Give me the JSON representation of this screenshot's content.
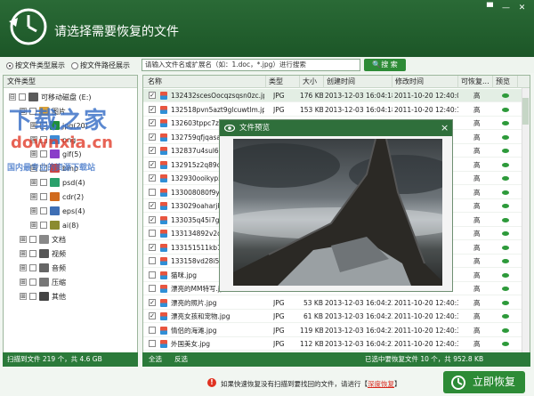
{
  "window": {
    "title": "请选择需要恢复的文件",
    "btn_menu": "▀",
    "btn_min": "—",
    "btn_close": "✕"
  },
  "toolbar": {
    "radio_type": "按文件类型展示",
    "radio_path": "按文件路径展示",
    "search_placeholder": "请输入文件名或扩展名（如：1.doc，*.jpg）进行搜索",
    "search_button": "搜 索"
  },
  "left_panel": {
    "header": "文件类型",
    "tree": [
      {
        "pm": "⊟",
        "label": "可移动磁盘 (E:)",
        "indent": 0
      },
      {
        "pm": "⊟",
        "label": "图片",
        "indent": 1
      },
      {
        "pm": "⊞",
        "label": "jpg(20)",
        "indent": 2
      },
      {
        "pm": "⊞",
        "label": "png",
        "indent": 2
      },
      {
        "pm": "⊞",
        "label": "gif(5)",
        "indent": 2
      },
      {
        "pm": "⊞",
        "label": "bmp",
        "indent": 2
      },
      {
        "pm": "⊞",
        "label": "psd(4)",
        "indent": 2
      },
      {
        "pm": "⊞",
        "label": "cdr(2)",
        "indent": 2
      },
      {
        "pm": "⊞",
        "label": "eps(4)",
        "indent": 2
      },
      {
        "pm": "⊞",
        "label": "ai(8)",
        "indent": 2
      },
      {
        "pm": "⊞",
        "label": "文档",
        "indent": 1
      },
      {
        "pm": "⊞",
        "label": "视频",
        "indent": 1
      },
      {
        "pm": "⊞",
        "label": "音频",
        "indent": 1
      },
      {
        "pm": "⊞",
        "label": "压缩",
        "indent": 1
      },
      {
        "pm": "⊞",
        "label": "其他",
        "indent": 1
      }
    ],
    "footer": "扫描到文件 219 个，共 4.6 GB"
  },
  "watermark": {
    "line1": "下载之家",
    "line2": "downxia.cn",
    "line3": "国内最专业的资源下载站"
  },
  "table": {
    "columns": [
      "名称",
      "类型",
      "大小",
      "创建时间",
      "修改时间",
      "可恢复...",
      "预览"
    ],
    "rows": [
      {
        "checked": true,
        "name": "132432scesOocqzsqsn0zc.jpg",
        "type": "JPG",
        "size": "176 KB",
        "created": "2013-12-03 16:04:18",
        "modified": "2011-10-20 12:40:08",
        "recover": "高"
      },
      {
        "checked": true,
        "name": "132518pvn5azt9glcuwtlm.jpg",
        "type": "JPG",
        "size": "153 KB",
        "created": "2013-12-03 16:04:18",
        "modified": "2011-10-20 12:40:10",
        "recover": "高"
      },
      {
        "checked": true,
        "name": "132603tppc7z89",
        "type": "",
        "size": "",
        "created": "",
        "modified": "",
        "recover": "高"
      },
      {
        "checked": true,
        "name": "132759qfjqasaa7",
        "type": "",
        "size": "",
        "created": "",
        "modified": "",
        "recover": "高"
      },
      {
        "checked": true,
        "name": "132837u4sul62f8",
        "type": "",
        "size": "",
        "created": "",
        "modified": "",
        "recover": "高"
      },
      {
        "checked": true,
        "name": "132915z2q89ccq6",
        "type": "",
        "size": "",
        "created": "",
        "modified": "",
        "recover": "高"
      },
      {
        "checked": true,
        "name": "132930ooikyp5h",
        "type": "",
        "size": "",
        "created": "",
        "modified": "",
        "recover": "高"
      },
      {
        "checked": false,
        "name": "133008080f9y7h",
        "type": "",
        "size": "",
        "created": "",
        "modified": "",
        "recover": "高"
      },
      {
        "checked": true,
        "name": "133029oaharjkoc",
        "type": "",
        "size": "",
        "created": "",
        "modified": "",
        "recover": "高"
      },
      {
        "checked": true,
        "name": "133035q45i7gq89",
        "type": "",
        "size": "",
        "created": "",
        "modified": "",
        "recover": "高"
      },
      {
        "checked": false,
        "name": "133134892v2ql9l",
        "type": "",
        "size": "",
        "created": "",
        "modified": "",
        "recover": "高"
      },
      {
        "checked": true,
        "name": "133151511kb1kt1",
        "type": "",
        "size": "",
        "created": "",
        "modified": "",
        "recover": "高"
      },
      {
        "checked": false,
        "name": "133158vd28i5f4k",
        "type": "",
        "size": "",
        "created": "",
        "modified": "",
        "recover": "高"
      },
      {
        "checked": false,
        "name": "猫咪.jpg",
        "type": "",
        "size": "",
        "created": "",
        "modified": "",
        "recover": "高"
      },
      {
        "checked": false,
        "name": "漂亮的MM特写.jp",
        "type": "",
        "size": "",
        "created": "",
        "modified": "",
        "recover": "高"
      },
      {
        "checked": true,
        "name": "漂亮的照片.jpg",
        "type": "JPG",
        "size": "53 KB",
        "created": "2013-12-03 16:04:23",
        "modified": "2011-10-20 12:40:34",
        "recover": "高"
      },
      {
        "checked": true,
        "name": "漂亮女孩和宠物.jpg",
        "type": "JPG",
        "size": "61 KB",
        "created": "2013-12-03 16:04:23",
        "modified": "2011-10-20 12:40:30",
        "recover": "高"
      },
      {
        "checked": false,
        "name": "情侣的海滩.jpg",
        "type": "JPG",
        "size": "119 KB",
        "created": "2013-12-03 16:04:23",
        "modified": "2011-10-20 12:40:34",
        "recover": "高"
      },
      {
        "checked": false,
        "name": "外国美女.jpg",
        "type": "JPG",
        "size": "112 KB",
        "created": "2013-12-03 16:04:23",
        "modified": "2011-10-20 12:40:38",
        "recover": "高"
      }
    ],
    "select_all": "全选",
    "invert": "反选",
    "footer_status": "已选中要恢复文件 10 个，共 952.8 KB"
  },
  "preview": {
    "title": "文件预览",
    "close": "×"
  },
  "bottom": {
    "message_pre": "如果快速恢复没有扫描到要找回的文件，请进行【",
    "deep_link": "深度恢复",
    "message_post": "】",
    "recover_button": "立即恢复",
    "warn_icon": "!"
  }
}
